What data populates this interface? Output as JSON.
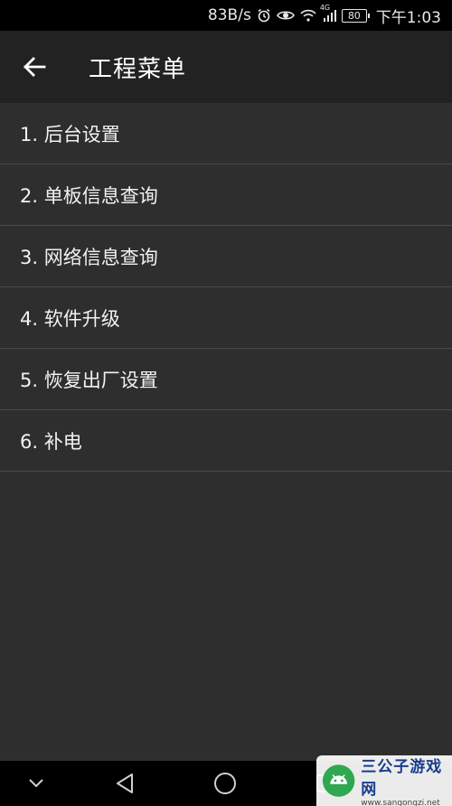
{
  "status_bar": {
    "speed": "83B/s",
    "network": "4G",
    "battery": "80",
    "time": "下午1:03"
  },
  "app_bar": {
    "title": "工程菜单"
  },
  "menu": {
    "items": [
      {
        "label": "1. 后台设置"
      },
      {
        "label": "2. 单板信息查询"
      },
      {
        "label": "3. 网络信息查询"
      },
      {
        "label": "4. 软件升级"
      },
      {
        "label": "5. 恢复出厂设置"
      },
      {
        "label": "6. 补电"
      }
    ]
  },
  "watermark": {
    "title": "三公子游戏网",
    "url": "www.sangongzi.net"
  },
  "colors": {
    "app_bar_bg": "#222222",
    "content_bg": "#2e2e2e",
    "divider": "#4a4a4a"
  }
}
